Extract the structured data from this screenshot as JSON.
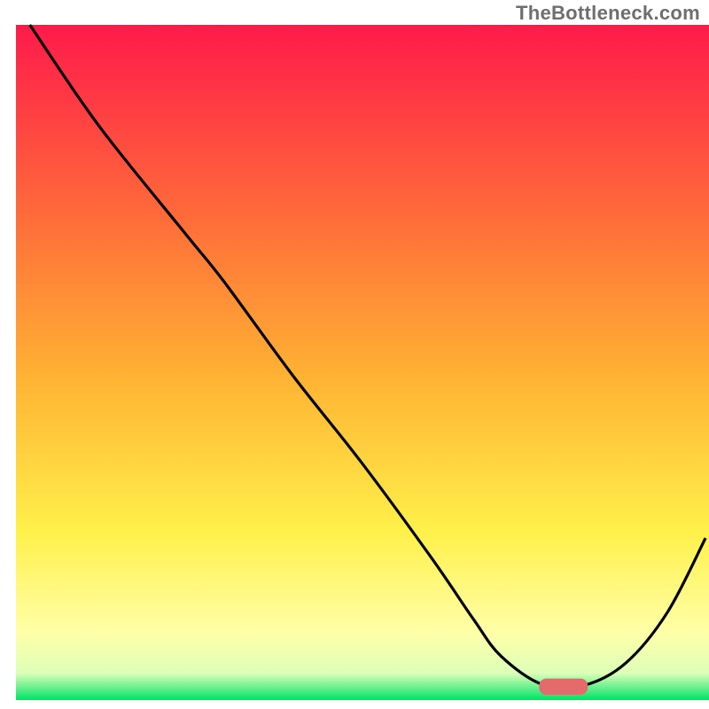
{
  "watermark": "TheBottleneck.com",
  "colors": {
    "gradient_top": "#ff1a4b",
    "gradient_upper_mid": "#ff6a3a",
    "gradient_mid": "#ffb233",
    "gradient_lower_mid": "#fff04a",
    "gradient_light": "#ffffa8",
    "gradient_band": "#ddffb8",
    "gradient_bottom": "#00e268",
    "curve": "#000000",
    "marker": "#e46a6c"
  },
  "chart_data": {
    "type": "line",
    "title": "",
    "xlabel": "",
    "ylabel": "",
    "xlim": [
      0,
      100
    ],
    "ylim": [
      0,
      100
    ],
    "grid": false,
    "legend": false,
    "x": [
      2,
      12,
      24.5,
      30,
      40,
      50,
      60,
      66,
      70,
      76,
      82,
      88,
      94,
      99.5
    ],
    "values": [
      100,
      85,
      69,
      62,
      48,
      35,
      21,
      12,
      6.5,
      2.3,
      2.2,
      5.5,
      13,
      24
    ],
    "marker": {
      "x_center": 79,
      "y": 2.0,
      "width": 7,
      "height": 2.4
    }
  }
}
